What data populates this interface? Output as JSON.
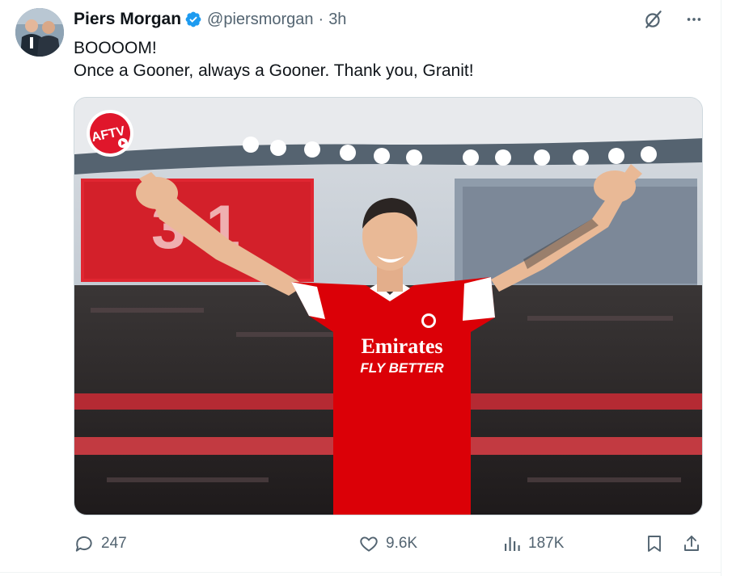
{
  "tweet": {
    "author_name": "Piers Morgan",
    "handle": "@piersmorgan",
    "separator": "·",
    "time": "3h",
    "lines": [
      "BOOOOM!",
      "Once a Gooner, always a Gooner. Thank you, Granit!"
    ]
  },
  "media": {
    "badge": "AFTV",
    "scoreboard": "3-1",
    "shirt_sponsor_line1": "Emirates",
    "shirt_sponsor_line2": "FLY BETTER"
  },
  "metrics": {
    "replies": "247",
    "likes": "9.6K",
    "views": "187K"
  },
  "colors": {
    "verified": "#1d9bf0",
    "text_primary": "#0f1419",
    "text_secondary": "#536471",
    "arsenal_red": "#db0007"
  },
  "icons": [
    "verified-badge-icon",
    "grok-icon",
    "more-icon",
    "reply-icon",
    "like-icon",
    "views-icon",
    "bookmark-icon",
    "share-icon"
  ]
}
